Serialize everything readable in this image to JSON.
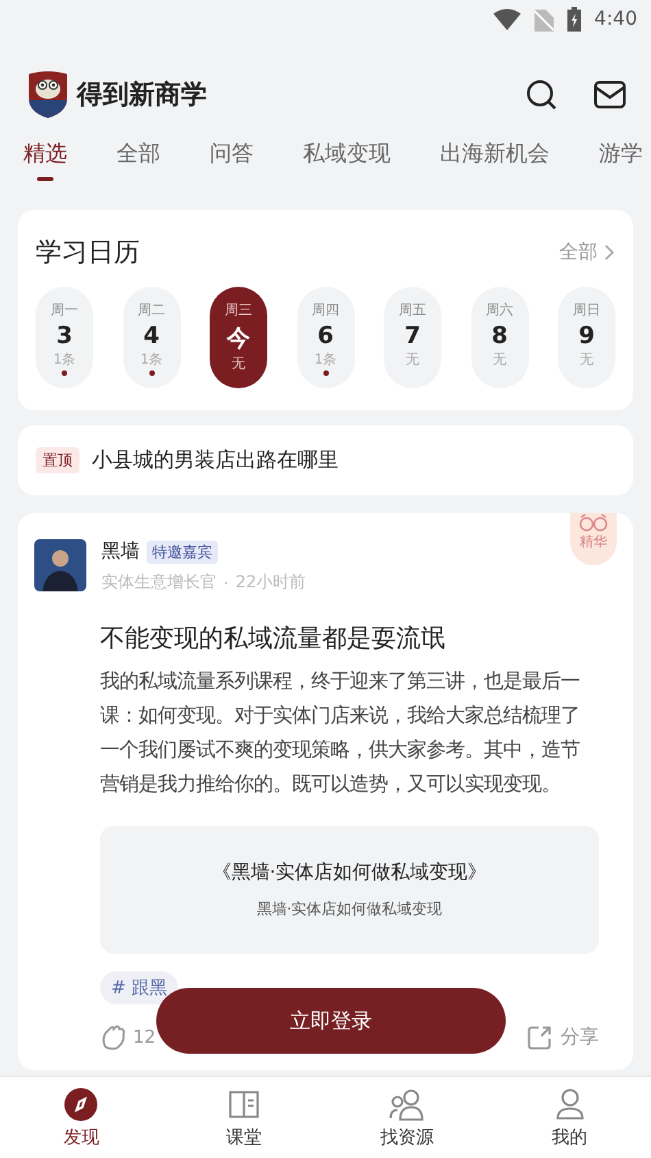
{
  "status_bar": {
    "time": "4:40"
  },
  "header": {
    "app_name": "得到新商学"
  },
  "tabs": [
    {
      "label": "精选",
      "selected": true
    },
    {
      "label": "全部",
      "selected": false
    },
    {
      "label": "问答",
      "selected": false
    },
    {
      "label": "私域变现",
      "selected": false
    },
    {
      "label": "出海新机会",
      "selected": false
    },
    {
      "label": "游学",
      "selected": false
    }
  ],
  "calendar": {
    "title": "学习日历",
    "all_link": "全部",
    "days": [
      {
        "weekday": "周一",
        "date": "3",
        "count": "1条",
        "has_dot": true,
        "selected": false
      },
      {
        "weekday": "周二",
        "date": "4",
        "count": "1条",
        "has_dot": true,
        "selected": false
      },
      {
        "weekday": "周三",
        "date": "今",
        "count": "无",
        "has_dot": false,
        "selected": true
      },
      {
        "weekday": "周四",
        "date": "6",
        "count": "1条",
        "has_dot": true,
        "selected": false
      },
      {
        "weekday": "周五",
        "date": "7",
        "count": "无",
        "has_dot": false,
        "selected": false
      },
      {
        "weekday": "周六",
        "date": "8",
        "count": "无",
        "has_dot": false,
        "selected": false
      },
      {
        "weekday": "周日",
        "date": "9",
        "count": "无",
        "has_dot": false,
        "selected": false
      }
    ]
  },
  "pinned": {
    "tag": "置顶",
    "title": "小县城的男装店出路在哪里"
  },
  "post": {
    "author": "黑墙",
    "badge": "特邀嘉宾",
    "role": "实体生意增长官",
    "separator": "·",
    "time": "22小时前",
    "essence": "精华",
    "title": "不能变现的私域流量都是耍流氓",
    "body": "我的私域流量系列课程，终于迎来了第三讲，也是最后一课：如何变现。对于实体门店来说，我给大家总结梳理了一个我们屡试不爽的变现策略，供大家参考。其中，造节营销是我力推给你的。既可以造势，又可以实现变现。",
    "course": {
      "title": "《黑墙·实体店如何做私域变现》",
      "subtitle": "黑墙·实体店如何做私域变现"
    },
    "topic": "# 跟黑",
    "likes": "12",
    "share": "分享"
  },
  "login_button": "立即登录",
  "bottom_nav": [
    {
      "label": "发现",
      "selected": true,
      "kind": "compass"
    },
    {
      "label": "课堂",
      "selected": false,
      "kind": "book"
    },
    {
      "label": "找资源",
      "selected": false,
      "kind": "people"
    },
    {
      "label": "我的",
      "selected": false,
      "kind": "person"
    }
  ]
}
